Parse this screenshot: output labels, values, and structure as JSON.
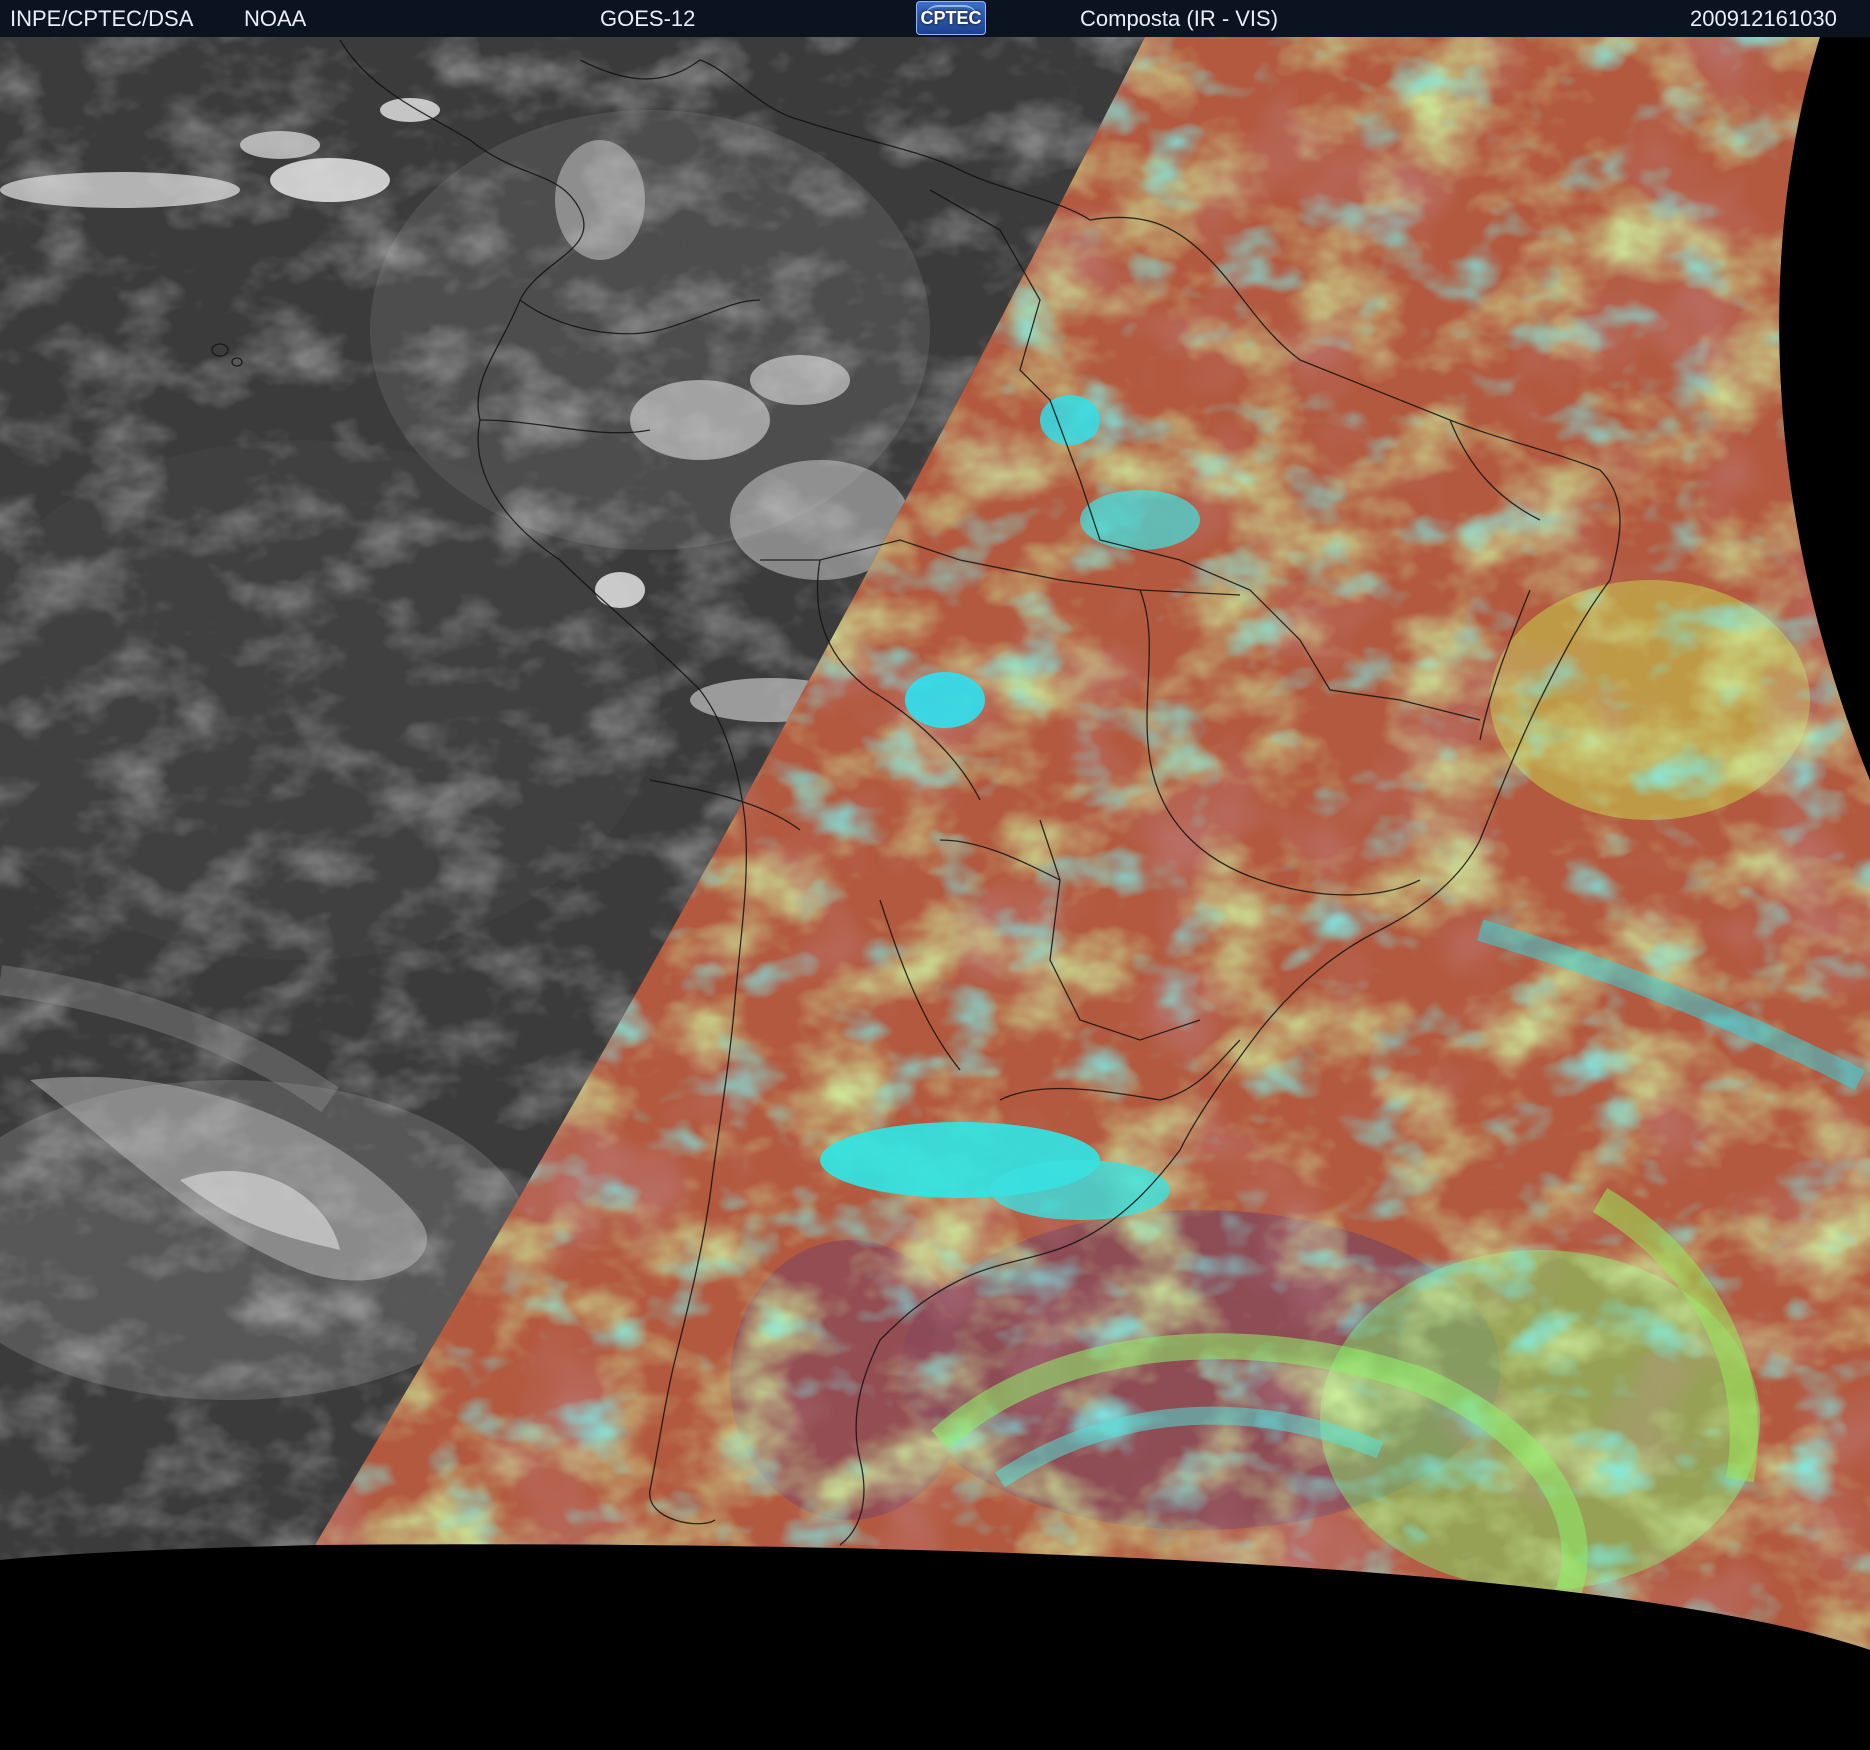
{
  "header": {
    "source": "INPE/CPTEC/DSA",
    "agency": "NOAA",
    "satellite": "GOES-12",
    "logo_text": "CPTEC",
    "product": "Composta (IR - VIS)",
    "timestamp": "200912161030"
  },
  "image": {
    "night_colors": [
      "#3a3a3a",
      "#5a5a5a",
      "#8a8a8a",
      "#d6d6d6"
    ],
    "day_colors": [
      "#b35a3f",
      "#8a4a58",
      "#9fe05a",
      "#2fe0e0"
    ],
    "space_color": "#000000"
  }
}
